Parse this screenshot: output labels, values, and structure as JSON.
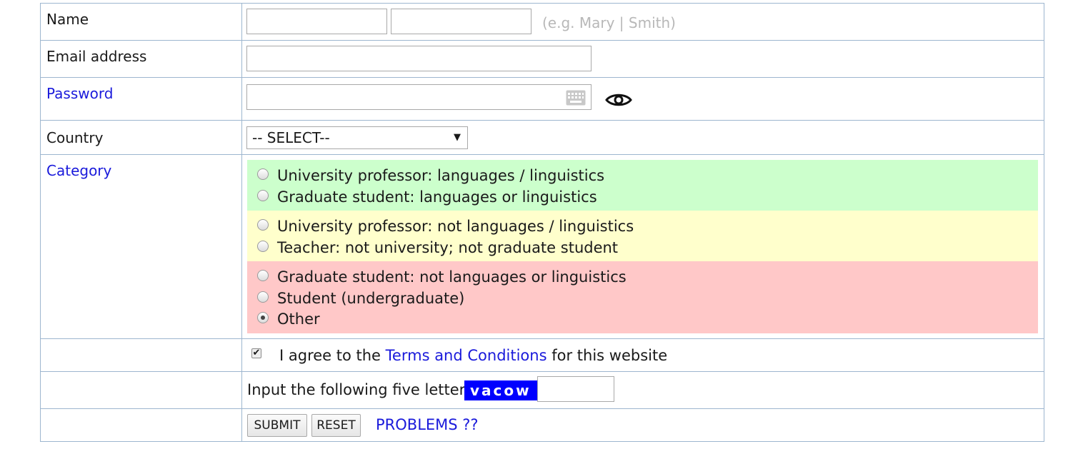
{
  "form": {
    "name": {
      "label": "Name",
      "first_value": "",
      "last_value": "",
      "hint": "(e.g. Mary | Smith)"
    },
    "email": {
      "label": "Email address",
      "value": ""
    },
    "password": {
      "label": "Password",
      "value": "",
      "keyboard_icon": "keyboard-icon",
      "toggle_icon": "eye-icon"
    },
    "country": {
      "label": "Country",
      "selected": "-- SELECT--"
    },
    "category": {
      "label": "Category",
      "groups": [
        {
          "color": "#ccffcc",
          "options": [
            {
              "label": "University professor: languages / linguistics",
              "checked": false
            },
            {
              "label": "Graduate student: languages or linguistics",
              "checked": false
            }
          ]
        },
        {
          "color": "#ffffcc",
          "options": [
            {
              "label": "University professor: not languages / linguistics",
              "checked": false
            },
            {
              "label": "Teacher: not university; not graduate student",
              "checked": false
            }
          ]
        },
        {
          "color": "#ffc8c8",
          "options": [
            {
              "label": "Graduate student: not languages or linguistics",
              "checked": false
            },
            {
              "label": "Student (undergraduate)",
              "checked": false
            },
            {
              "label": "Other",
              "checked": true
            }
          ]
        }
      ]
    },
    "terms": {
      "checked": true,
      "prefix": "I agree to the",
      "link": "Terms and Conditions",
      "suffix": "for this website"
    },
    "captcha": {
      "prompt": "Input the following five letters:",
      "code": "vacow",
      "value": ""
    },
    "actions": {
      "submit": "SUBMIT",
      "reset": "RESET",
      "problems": "PROBLEMS ??"
    }
  },
  "colors": {
    "link": "#1a1adb",
    "border": "#9db6cf",
    "captcha_bg": "#0000ff"
  }
}
